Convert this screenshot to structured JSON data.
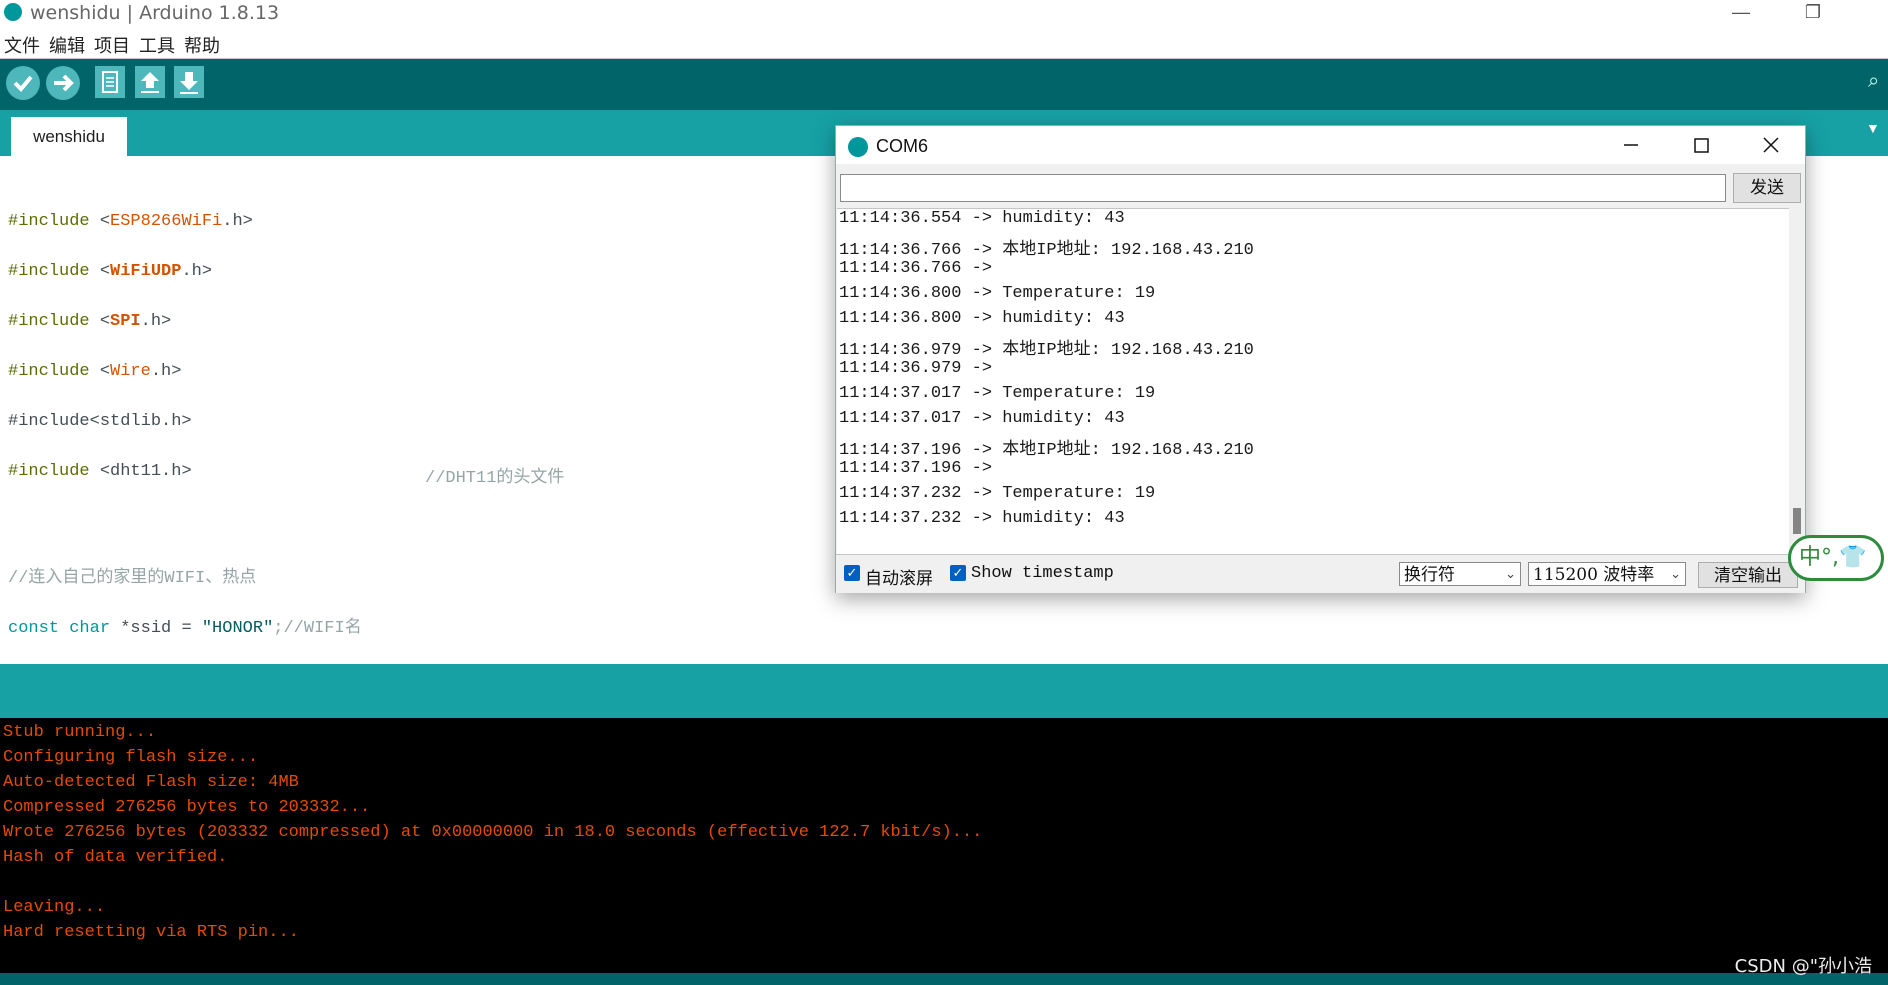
{
  "window": {
    "title": "wenshidu | Arduino 1.8.13",
    "minimize": "—",
    "restore": "❐"
  },
  "menu": [
    "文件",
    "编辑",
    "项目",
    "工具",
    "帮助"
  ],
  "toolbar": {
    "verify_icon": "check-icon",
    "upload_icon": "arrow-right-icon",
    "new_icon": "file-icon",
    "open_icon": "arrow-up-icon",
    "save_icon": "arrow-down-icon"
  },
  "tab": {
    "label": "wenshidu"
  },
  "code": {
    "l1_inc": "#include",
    "l1_lib": "ESP8266WiFi",
    "l2_inc": "#include",
    "l2_lib": "WiFiUDP",
    "l3_inc": "#include",
    "l3_lib": "SPI",
    "l4_inc": "#include",
    "l4_lib": "Wire",
    "l5": "#include<stdlib.h>",
    "l6_inc": "#include",
    "l6_rest": "<dht11.h>",
    "l6_cmt": "//DHT11的头文件",
    "l7": "//连入自己的家里的WIFI、热点",
    "l8_kw1": "const",
    "l8_kw2": "char",
    "l8_mid": "*ssid = ",
    "l8_str": "\"HONOR\"",
    "l8_cmt": ";//WIFI名"
  },
  "console": [
    "Stub running...",
    "Configuring flash size...",
    "Auto-detected Flash size: 4MB",
    "Compressed 276256 bytes to 203332...",
    "Wrote 276256 bytes (203332 compressed) at 0x00000000 in 18.0 seconds (effective 122.7 kbit/s)...",
    "Hash of data verified.",
    "",
    "Leaving...",
    "Hard resetting via RTS pin..."
  ],
  "serial": {
    "title": "COM6",
    "send_label": "发送",
    "lines": [
      "11:14:36.554 -> humidity: 43",
      "11:14:36.766 -> 本地IP地址: 192.168.43.210",
      "11:14:36.766 ->",
      "11:14:36.800 -> Temperature: 19",
      "11:14:36.800 -> humidity: 43",
      "11:14:36.979 -> 本地IP地址: 192.168.43.210",
      "11:14:36.979 ->",
      "11:14:37.017 -> Temperature: 19",
      "11:14:37.017 -> humidity: 43",
      "11:14:37.196 -> 本地IP地址: 192.168.43.210",
      "11:14:37.196 ->",
      "11:14:37.232 -> Temperature: 19",
      "11:14:37.232 -> humidity: 43"
    ],
    "autoscroll_label": "自动滚屏",
    "timestamp_label": "Show timestamp",
    "line_ending": "换行符",
    "baud": "115200 波特率",
    "clear_label": "清空输出"
  },
  "ime": {
    "text": "中°,👕"
  },
  "watermark": "CSDN @\"孙小浩",
  "colors": {
    "toolbar": "#006468",
    "tabbar": "#17a1a5",
    "console_text": "#e34c00",
    "ime_green": "#2e8b3e"
  }
}
